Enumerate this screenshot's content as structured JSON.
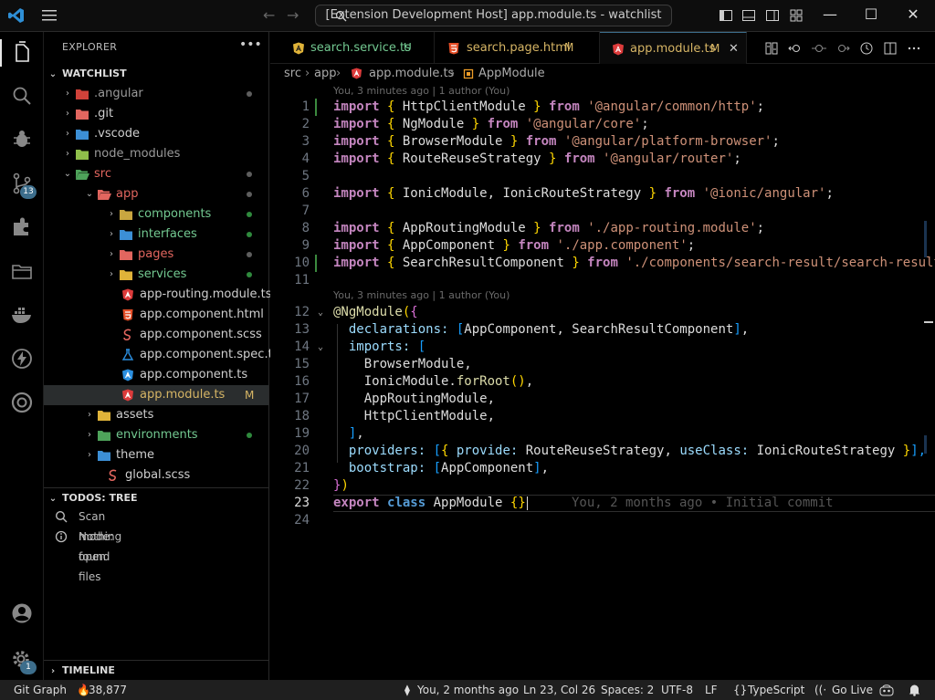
{
  "titlebar": {
    "command_center": "[Extension Development Host] app.module.ts - watchlist"
  },
  "activity": {
    "source_control_badge": "13",
    "accounts_badge": "1"
  },
  "sidebar": {
    "title": "EXPLORER",
    "more": "•••",
    "workspace": "WATCHLIST",
    "tree": [
      {
        "label": ".angular",
        "depth": 1,
        "kind": "folder",
        "color": "dim",
        "dot": "grey"
      },
      {
        "label": ".git",
        "depth": 1,
        "kind": "folder",
        "color": "white"
      },
      {
        "label": ".vscode",
        "depth": 1,
        "kind": "folder",
        "color": "white"
      },
      {
        "label": "node_modules",
        "depth": 1,
        "kind": "folder",
        "color": "dim"
      },
      {
        "label": "src",
        "depth": 1,
        "kind": "folder-open",
        "color": "red",
        "dot": "grey"
      },
      {
        "label": "app",
        "depth": 2,
        "kind": "folder-open",
        "color": "red",
        "dot": "grey"
      },
      {
        "label": "components",
        "depth": 3,
        "kind": "folder",
        "color": "green",
        "dot": "green"
      },
      {
        "label": "interfaces",
        "depth": 3,
        "kind": "folder",
        "color": "green",
        "dot": "green"
      },
      {
        "label": "pages",
        "depth": 3,
        "kind": "folder",
        "color": "red",
        "dot": "grey"
      },
      {
        "label": "services",
        "depth": 3,
        "kind": "folder",
        "color": "green",
        "dot": "green"
      },
      {
        "label": "app-routing.module.ts",
        "depth": 4,
        "kind": "angular",
        "color": "white"
      },
      {
        "label": "app.component.html",
        "depth": 4,
        "kind": "html",
        "color": "white"
      },
      {
        "label": "app.component.scss",
        "depth": 4,
        "kind": "scss",
        "color": "white"
      },
      {
        "label": "app.component.spec.ts",
        "depth": 4,
        "kind": "spec",
        "color": "white"
      },
      {
        "label": "app.component.ts",
        "depth": 4,
        "kind": "angular-blue",
        "color": "white"
      },
      {
        "label": "app.module.ts",
        "depth": 4,
        "kind": "angular",
        "color": "yellow",
        "mark": "M",
        "selected": true
      },
      {
        "label": "assets",
        "depth": 2,
        "kind": "folder",
        "color": "white"
      },
      {
        "label": "environments",
        "depth": 2,
        "kind": "folder",
        "color": "green",
        "dot": "green"
      },
      {
        "label": "theme",
        "depth": 2,
        "kind": "folder",
        "color": "white"
      },
      {
        "label": "global.scss",
        "depth": 3,
        "kind": "scss",
        "color": "white"
      }
    ],
    "todos_title": "TODOS: TREE",
    "todos": [
      "Scan mode: open files",
      "Nothing found"
    ],
    "timeline_title": "TIMELINE"
  },
  "tabs": [
    {
      "label": "search.service.ts",
      "mark": "U",
      "icon": "angular-yellow",
      "color": "#73c991"
    },
    {
      "label": "search.page.html",
      "mark": "M",
      "icon": "html",
      "color": "#d6b565"
    },
    {
      "label": "app.module.ts",
      "mark": "M",
      "icon": "angular",
      "color": "#d6b565",
      "active": true
    }
  ],
  "breadcrumb": [
    "src",
    "app",
    "app.module.ts",
    "AppModule"
  ],
  "editor": {
    "lens1": "You, 3 minutes ago | 1 author (You)",
    "lens2": "You, 3 minutes ago | 1 author (You)",
    "blame": "You, 2 months ago • Initial commit",
    "lines": [
      [
        [
          "import ",
          "k"
        ],
        [
          "{ ",
          "b1"
        ],
        [
          "HttpClientModule ",
          "t"
        ],
        [
          "} ",
          "b1"
        ],
        [
          "from ",
          "k"
        ],
        [
          "'@angular/common/http'",
          "s"
        ],
        [
          ";",
          "t"
        ]
      ],
      [
        [
          "import ",
          "k"
        ],
        [
          "{ ",
          "b1"
        ],
        [
          "NgModule ",
          "t"
        ],
        [
          "} ",
          "b1"
        ],
        [
          "from ",
          "k"
        ],
        [
          "'@angular/core'",
          "s"
        ],
        [
          ";",
          "t"
        ]
      ],
      [
        [
          "import ",
          "k"
        ],
        [
          "{ ",
          "b1"
        ],
        [
          "BrowserModule ",
          "t"
        ],
        [
          "} ",
          "b1"
        ],
        [
          "from ",
          "k"
        ],
        [
          "'@angular/platform-browser'",
          "s"
        ],
        [
          ";",
          "t"
        ]
      ],
      [
        [
          "import ",
          "k"
        ],
        [
          "{ ",
          "b1"
        ],
        [
          "RouteReuseStrategy ",
          "t"
        ],
        [
          "} ",
          "b1"
        ],
        [
          "from ",
          "k"
        ],
        [
          "'@angular/router'",
          "s"
        ],
        [
          ";",
          "t"
        ]
      ],
      [],
      [
        [
          "import ",
          "k"
        ],
        [
          "{ ",
          "b1"
        ],
        [
          "IonicModule, IonicRouteStrategy ",
          "t"
        ],
        [
          "} ",
          "b1"
        ],
        [
          "from ",
          "k"
        ],
        [
          "'@ionic/angular'",
          "s"
        ],
        [
          ";",
          "t"
        ]
      ],
      [],
      [
        [
          "import ",
          "k"
        ],
        [
          "{ ",
          "b1"
        ],
        [
          "AppRoutingModule ",
          "t"
        ],
        [
          "} ",
          "b1"
        ],
        [
          "from ",
          "k"
        ],
        [
          "'./app-routing.module'",
          "s"
        ],
        [
          ";",
          "t"
        ]
      ],
      [
        [
          "import ",
          "k"
        ],
        [
          "{ ",
          "b1"
        ],
        [
          "AppComponent ",
          "t"
        ],
        [
          "} ",
          "b1"
        ],
        [
          "from ",
          "k"
        ],
        [
          "'./app.component'",
          "s"
        ],
        [
          ";",
          "t"
        ]
      ],
      [
        [
          "import ",
          "k"
        ],
        [
          "{ ",
          "b1"
        ],
        [
          "SearchResultComponent ",
          "t"
        ],
        [
          "} ",
          "b1"
        ],
        [
          "from ",
          "k"
        ],
        [
          "'./components/search-result/search-result.component'",
          "s"
        ],
        [
          ";",
          "t"
        ]
      ],
      [],
      [
        [
          "@NgModule",
          "dec"
        ],
        [
          "(",
          "b1"
        ],
        [
          "{",
          "b2"
        ]
      ],
      [
        [
          "  declarations: ",
          "p"
        ],
        [
          "[",
          "b3"
        ],
        [
          "AppComponent, SearchResultComponent",
          "t"
        ],
        [
          "]",
          "b3"
        ],
        [
          ",",
          "t"
        ]
      ],
      [
        [
          "  imports: ",
          "p"
        ],
        [
          "[",
          "b3"
        ]
      ],
      [
        [
          "    BrowserModule,",
          "t"
        ]
      ],
      [
        [
          "    IonicModule.",
          "t"
        ],
        [
          "forRoot",
          "f"
        ],
        [
          "()",
          "b1"
        ],
        [
          ",",
          "t"
        ]
      ],
      [
        [
          "    AppRoutingModule,",
          "t"
        ]
      ],
      [
        [
          "    HttpClientModule,",
          "t"
        ]
      ],
      [
        [
          "  ",
          "t"
        ],
        [
          "]",
          "b3"
        ],
        [
          ",",
          "t"
        ]
      ],
      [
        [
          "  providers: ",
          "p"
        ],
        [
          "[",
          "b3"
        ],
        [
          "{ ",
          "b1"
        ],
        [
          "provide: ",
          "p"
        ],
        [
          "RouteReuseStrategy, ",
          "t"
        ],
        [
          "useClass: ",
          "p"
        ],
        [
          "IonicRouteStrategy ",
          "t"
        ],
        [
          "}",
          "b1"
        ],
        [
          "],",
          "b3"
        ]
      ],
      [
        [
          "  bootstrap: ",
          "p"
        ],
        [
          "[",
          "b3"
        ],
        [
          "AppComponent",
          "t"
        ],
        [
          "]",
          "b3"
        ],
        [
          ",",
          "t"
        ]
      ],
      [
        [
          "}",
          "b2"
        ],
        [
          ")",
          "b1"
        ]
      ],
      [
        [
          "export ",
          "k"
        ],
        [
          "class ",
          "kb"
        ],
        [
          "AppModule ",
          "t"
        ],
        [
          "{}",
          "b1"
        ]
      ],
      []
    ]
  },
  "statusbar": {
    "git_graph": "Git Graph",
    "count": "38,877",
    "blame": "You, 2 months ago",
    "position": "Ln 23, Col 26",
    "spaces": "Spaces: 2",
    "encoding": "UTF-8",
    "eol": "LF",
    "language": "TypeScript",
    "golive": "Go Live"
  },
  "colors": {
    "accent": "#3d6e8c",
    "modified": "#d6b565",
    "untracked": "#73c991",
    "angular": "#e2665f"
  }
}
